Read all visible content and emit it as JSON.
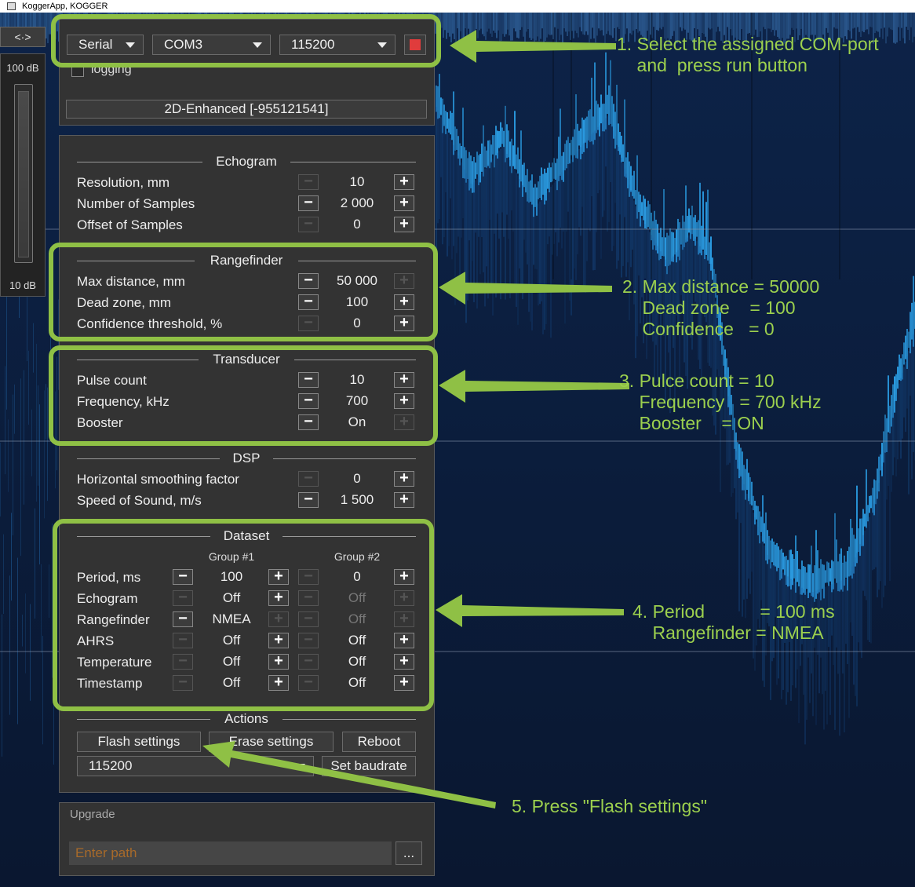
{
  "titlebar": {
    "title": "KoggerApp, KOGGER"
  },
  "gain": {
    "toggle_label": "<·>",
    "max_label": "100 dB",
    "min_label": "10 dB"
  },
  "connection": {
    "type": "Serial",
    "port": "COM3",
    "baud": "115200",
    "logging_label": "logging",
    "mode_label": "2D-Enhanced [-955121541]"
  },
  "echogram": {
    "title": "Echogram",
    "resolution_label": "Resolution, mm",
    "resolution": "10",
    "samples_label": "Number of Samples",
    "samples": "2 000",
    "offset_label": "Offset of Samples",
    "offset": "0"
  },
  "rangefinder": {
    "title": "Rangefinder",
    "max_label": "Max distance, mm",
    "max": "50 000",
    "dead_label": "Dead zone, mm",
    "dead": "100",
    "conf_label": "Confidence threshold, %",
    "conf": "0"
  },
  "transducer": {
    "title": "Transducer",
    "pulse_label": "Pulse count",
    "pulse": "10",
    "freq_label": "Frequency, kHz",
    "freq": "700",
    "booster_label": "Booster",
    "booster": "On"
  },
  "dsp": {
    "title": "DSP",
    "smooth_label": "Horizontal smoothing factor",
    "smooth": "0",
    "sos_label": "Speed of Sound, m/s",
    "sos": "1 500"
  },
  "dataset": {
    "title": "Dataset",
    "group1": "Group #1",
    "group2": "Group #2",
    "period_label": "Period, ms",
    "period_g1": "100",
    "period_g2": "0",
    "echogram_label": "Echogram",
    "echogram_g1": "Off",
    "echogram_g2": "Off",
    "rangefinder_label": "Rangefinder",
    "rangefinder_g1": "NMEA",
    "rangefinder_g2": "Off",
    "ahrs_label": "AHRS",
    "ahrs_g1": "Off",
    "ahrs_g2": "Off",
    "temperature_label": "Temperature",
    "temperature_g1": "Off",
    "temperature_g2": "Off",
    "timestamp_label": "Timestamp",
    "timestamp_g1": "Off",
    "timestamp_g2": "Off"
  },
  "actions": {
    "title": "Actions",
    "flash": "Flash settings",
    "erase": "Erase settings",
    "reboot": "Reboot",
    "baud": "115200",
    "set_baud": "Set baudrate"
  },
  "upgrade": {
    "title": "Upgrade",
    "path_placeholder": "Enter path",
    "browse": "..."
  },
  "annotations": {
    "step1": "1. Select the assigned COM-port\n    and  press run button",
    "step2": "2. Max distance = 50000\n    Dead zone    = 100\n    Confidence   = 0",
    "step3": "3. Pulce count = 10\n    Frequency   = 700 kHz\n    Booster    = ON",
    "step4": "4. Period           = 100 ms\n    Rangefinder = NMEA",
    "step5": "5. Press \"Flash settings\""
  },
  "colors": {
    "highlight": "#8fc045",
    "note_text": "#9cd04e",
    "run_button": "#e03c3c",
    "sonar": "#2a9ae0",
    "panel": "#333333"
  },
  "icons": {
    "run": "stop-square-icon",
    "dropdown": "chevron-down-icon"
  }
}
